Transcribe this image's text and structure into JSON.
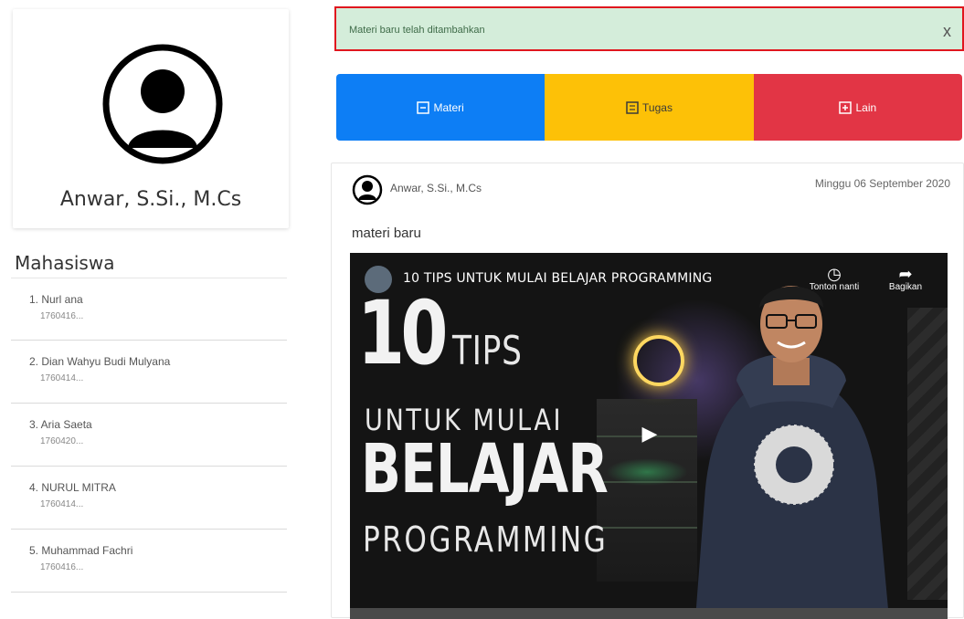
{
  "profile": {
    "name": "Anwar, S.Si., M.Cs"
  },
  "students": {
    "title": "Mahasiswa",
    "items": [
      {
        "name": "1. Nurl ana",
        "nim": "1760416..."
      },
      {
        "name": "2. Dian Wahyu Budi Mulyana",
        "nim": "1760414..."
      },
      {
        "name": "3. Aria Saeta",
        "nim": "1760420..."
      },
      {
        "name": "4. NURUL MITRA",
        "nim": "1760414..."
      },
      {
        "name": "5. Muhammad Fachri",
        "nim": "1760416..."
      }
    ]
  },
  "alert": {
    "message": "Materi baru telah ditambahkan",
    "close": "x"
  },
  "actions": {
    "materi": "Materi",
    "tugas": "Tugas",
    "lain": "Lain"
  },
  "post": {
    "author": "Anwar, S.Si., M.Cs",
    "date": "Minggu 06 September 2020",
    "text": "materi baru"
  },
  "video": {
    "title": "10 TIPS UNTUK MULAI BELAJAR PROGRAMMING",
    "thumb_big_number": "10",
    "thumb_tips": "TIPS",
    "thumb_line1": "UNTUK MULAI",
    "thumb_line2": "BELAJAR",
    "thumb_line3": "PROGRAMMING",
    "watch_later": "Tonton nanti",
    "share": "Bagikan"
  },
  "colors": {
    "blue": "#0d7ef5",
    "yellow": "#fdc107",
    "red": "#e23545",
    "alert_bg": "#d4edda"
  }
}
